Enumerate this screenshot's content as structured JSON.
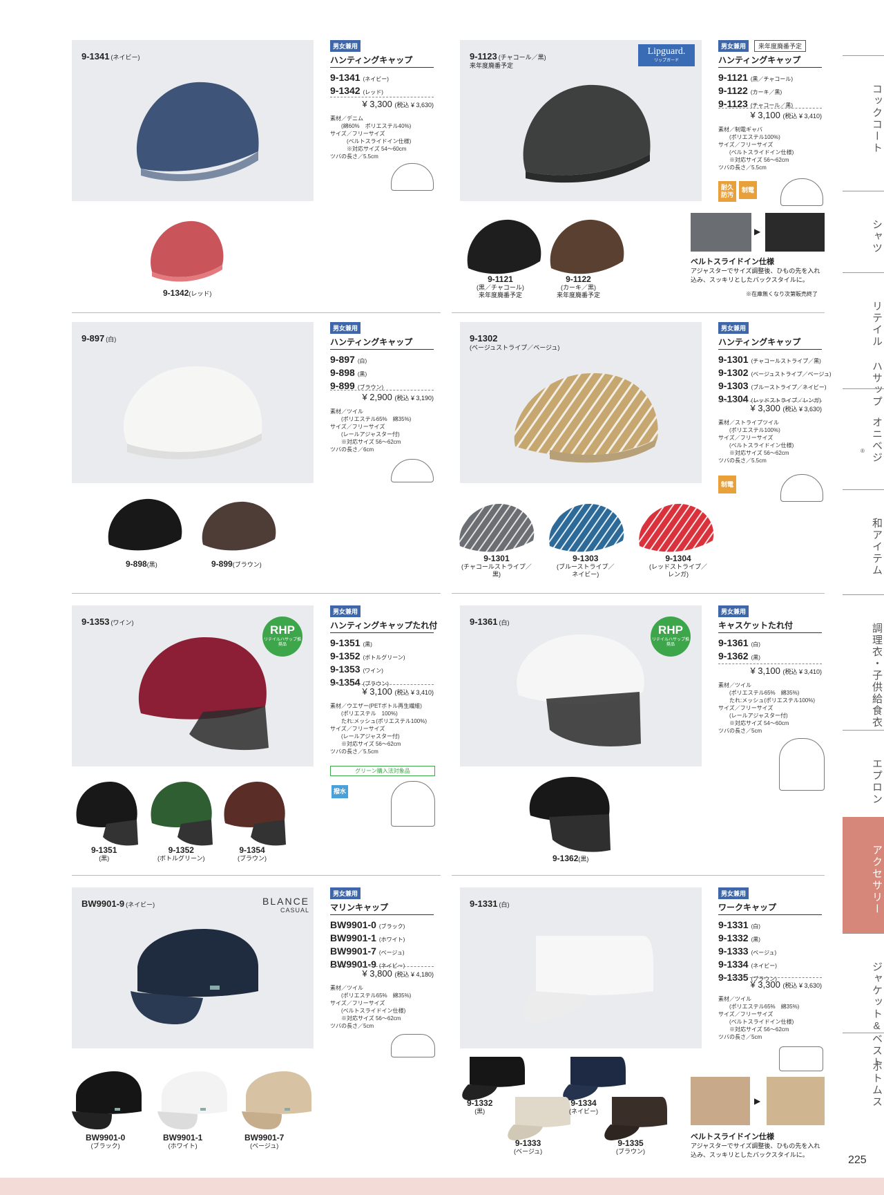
{
  "sidebar": [
    {
      "label": "コックコート"
    },
    {
      "label": "シャツ"
    },
    {
      "label": "リテイル ハサップ"
    },
    {
      "label": "オニベジ"
    },
    {
      "label": "和アイテム"
    },
    {
      "label": "調理衣・子供給食衣"
    },
    {
      "label": "エプロン"
    },
    {
      "label": "アクセサリー"
    },
    {
      "label": "ジャケット&ベスト"
    },
    {
      "label": "ボトムス"
    }
  ],
  "sidebar_small": "®",
  "page_number": "225",
  "common": {
    "unisex": "男女兼用",
    "tax_label": "(税込 ¥ 3,630)"
  },
  "p1": {
    "main_code": "9-1341",
    "main_color": "(ネイビー)",
    "title": "ハンティングキャップ",
    "codes": [
      {
        "code": "9-1341",
        "color": "(ネイビー)"
      },
      {
        "code": "9-1342",
        "color": "(レッド)"
      }
    ],
    "price": "¥ 3,300",
    "tax": "(税込 ¥ 3,630)",
    "spec": "素材／デニム\n　　(綿60%　ポリエステル40%)\nサイズ／フリーサイズ\n　　　(ベルトスライドイン仕様)\n　　　※対応サイズ 54〜60cm\nツバの長さ／5.5cm",
    "variants": [
      {
        "code": "9-1342",
        "color": "(レッド)"
      }
    ]
  },
  "p2": {
    "main_code": "9-1123",
    "main_color": "(チャコール／黒)",
    "sub": "来年度廃番予定",
    "logo": "Lipguard.",
    "logo_sub": "リップガード",
    "tag2": "来年度廃番予定",
    "title": "ハンティングキャップ",
    "codes": [
      {
        "code": "9-1121",
        "color": "(黒／チャコール)"
      },
      {
        "code": "9-1122",
        "color": "(カーキ／黒)"
      },
      {
        "code": "9-1123",
        "color": "(チャコール／黒)"
      }
    ],
    "price": "¥ 3,100",
    "tax": "(税込 ¥ 3,410)",
    "spec": "素材／制電ギャバ\n　　(ポリエステル100%)\nサイズ／フリーサイズ\n　　(ベルトスライドイン仕様)\n　　※対応サイズ 56〜62cm\nツバの長さ／5.5cm",
    "badges": [
      "耐久防汚",
      "制電"
    ],
    "variants": [
      {
        "code": "9-1121",
        "color": "(黒／チャコール)",
        "note": "来年度廃番予定"
      },
      {
        "code": "9-1122",
        "color": "(カーキ／黒)",
        "note": "来年度廃番予定"
      }
    ],
    "belt_title": "ベルトスライドイン仕様",
    "belt_text": "アジャスターでサイズ調整後、ひもの先を入れ込み、スッキリとしたバックスタイルに。",
    "stock_note": "※在庫無くなり次第販売終了"
  },
  "p3": {
    "main_code": "9-897",
    "main_color": "(白)",
    "title": "ハンティングキャップ",
    "codes": [
      {
        "code": "9-897",
        "color": "(白)"
      },
      {
        "code": "9-898",
        "color": "(黒)"
      },
      {
        "code": "9-899",
        "color": "(ブラウン)"
      }
    ],
    "price": "¥ 2,900",
    "tax": "(税込 ¥ 3,190)",
    "spec": "素材／ツイル\n　　(ポリエステル65%　綿35%)\nサイズ／フリーサイズ\n　　(レールアジャスター付)\n　　※対応サイズ 56〜62cm\nツバの長さ／6cm",
    "variants": [
      {
        "code": "9-898",
        "color": "(黒)"
      },
      {
        "code": "9-899",
        "color": "(ブラウン)"
      }
    ]
  },
  "p4": {
    "main_code": "9-1302",
    "main_color": "(ベージュストライプ／ベージュ)",
    "title": "ハンティングキャップ",
    "codes": [
      {
        "code": "9-1301",
        "color": "(チャコールストライプ／黒)"
      },
      {
        "code": "9-1302",
        "color": "(ベージュストライプ／ベージュ)"
      },
      {
        "code": "9-1303",
        "color": "(ブルーストライプ／ネイビー)"
      },
      {
        "code": "9-1304",
        "color": "(レッドストライプ／レンガ)"
      }
    ],
    "price": "¥ 3,300",
    "tax": "(税込 ¥ 3,630)",
    "spec": "素材／ストライプツイル\n　　(ポリエステル100%)\nサイズ／フリーサイズ\n　　(ベルトスライドイン仕様)\n　　※対応サイズ 56〜62cm\nツバの長さ／5.5cm",
    "badge": "制電",
    "variants": [
      {
        "code": "9-1301",
        "color": "(チャコールストライプ／",
        "color2": "黒)"
      },
      {
        "code": "9-1303",
        "color": "(ブルーストライプ／",
        "color2": "ネイビー)"
      },
      {
        "code": "9-1304",
        "color": "(レッドストライプ／",
        "color2": "レンガ)"
      }
    ]
  },
  "p5": {
    "main_code": "9-1353",
    "main_color": "(ワイン)",
    "rhp": "RHP",
    "rhp_sub": "リテイルハサップ推奨品",
    "title": "ハンティングキャップたれ付",
    "codes": [
      {
        "code": "9-1351",
        "color": "(黒)"
      },
      {
        "code": "9-1352",
        "color": "(ボトルグリーン)"
      },
      {
        "code": "9-1353",
        "color": "(ワイン)"
      },
      {
        "code": "9-1354",
        "color": "(ブラウン)"
      }
    ],
    "price": "¥ 3,100",
    "tax": "(税込 ¥ 3,410)",
    "spec": "素材／ウエザー(PETボトル再生繊維)\n　　(ポリエステル　100%)\n　　たれ:メッシュ(ポリエステル100%)\nサイズ／フリーサイズ\n　　(レールアジャスター付)\n　　※対応サイズ 56〜62cm\nツバの長さ／5.5cm",
    "green": "グリーン購入法対象品",
    "badge": "撥水",
    "variants": [
      {
        "code": "9-1351",
        "color": "(黒)"
      },
      {
        "code": "9-1352",
        "color": "(ボトルグリーン)"
      },
      {
        "code": "9-1354",
        "color": "(ブラウン)"
      }
    ]
  },
  "p6": {
    "main_code": "9-1361",
    "main_color": "(白)",
    "rhp": "RHP",
    "rhp_sub": "リテイルハサップ推奨品",
    "title": "キャスケットたれ付",
    "codes": [
      {
        "code": "9-1361",
        "color": "(白)"
      },
      {
        "code": "9-1362",
        "color": "(黒)"
      }
    ],
    "price": "¥ 3,100",
    "tax": "(税込 ¥ 3,410)",
    "spec": "素材／ツイル\n　　(ポリエステル65%　綿35%)\n　　たれ:メッシュ(ポリエステル100%)\nサイズ／フリーサイズ\n　　(レールアジャスター付)\n　　※対応サイズ 54〜60cm\nツバの長さ／5cm",
    "variants": [
      {
        "code": "9-1362",
        "color": "(黒)"
      }
    ]
  },
  "p7": {
    "main_code": "BW9901-9",
    "main_color": "(ネイビー)",
    "logo": "BLANCE",
    "logo_sub": "CASUAL",
    "title": "マリンキャップ",
    "codes": [
      {
        "code": "BW9901-0",
        "color": "(ブラック)"
      },
      {
        "code": "BW9901-1",
        "color": "(ホワイト)"
      },
      {
        "code": "BW9901-7",
        "color": "(ベージュ)"
      },
      {
        "code": "BW9901-9",
        "color": "(ネイビー)"
      }
    ],
    "price": "¥ 3,800",
    "tax": "(税込 ¥ 4,180)",
    "spec": "素材／ツイル\n　　(ポリエステル65%　綿35%)\nサイズ／フリーサイズ\n　　(ベルトスライドイン仕様)\n　　※対応サイズ 56〜62cm\nツバの長さ／5cm",
    "variants": [
      {
        "code": "BW9901-0",
        "color": "(ブラック)"
      },
      {
        "code": "BW9901-1",
        "color": "(ホワイト)"
      },
      {
        "code": "BW9901-7",
        "color": "(ベージュ)"
      }
    ]
  },
  "p8": {
    "main_code": "9-1331",
    "main_color": "(白)",
    "title": "ワークキャップ",
    "codes": [
      {
        "code": "9-1331",
        "color": "(白)"
      },
      {
        "code": "9-1332",
        "color": "(黒)"
      },
      {
        "code": "9-1333",
        "color": "(ベージュ)"
      },
      {
        "code": "9-1334",
        "color": "(ネイビー)"
      },
      {
        "code": "9-1335",
        "color": "(ブラウン)"
      }
    ],
    "price": "¥ 3,300",
    "tax": "(税込 ¥ 3,630)",
    "spec": "素材／ツイル\n　　(ポリエステル65%　綿35%)\nサイズ／フリーサイズ\n　　(ベルトスライドイン仕様)\n　　※対応サイズ 56〜62cm\nツバの長さ／5cm",
    "variants": [
      {
        "code": "9-1332",
        "color": "(黒)"
      },
      {
        "code": "9-1334",
        "color": "(ネイビー)"
      },
      {
        "code": "9-1333",
        "color": "(ベージュ)"
      },
      {
        "code": "9-1335",
        "color": "(ブラウン)"
      }
    ],
    "belt_title": "ベルトスライドイン仕様",
    "belt_text": "アジャスターでサイズ調整後、ひもの先を入れ込み、スッキリとしたバックスタイルに。"
  },
  "colors": {
    "tag": "#3e66a8",
    "accent": "#d7877a",
    "rhp": "#3da64b",
    "badge_orange": "#e8a13a"
  }
}
